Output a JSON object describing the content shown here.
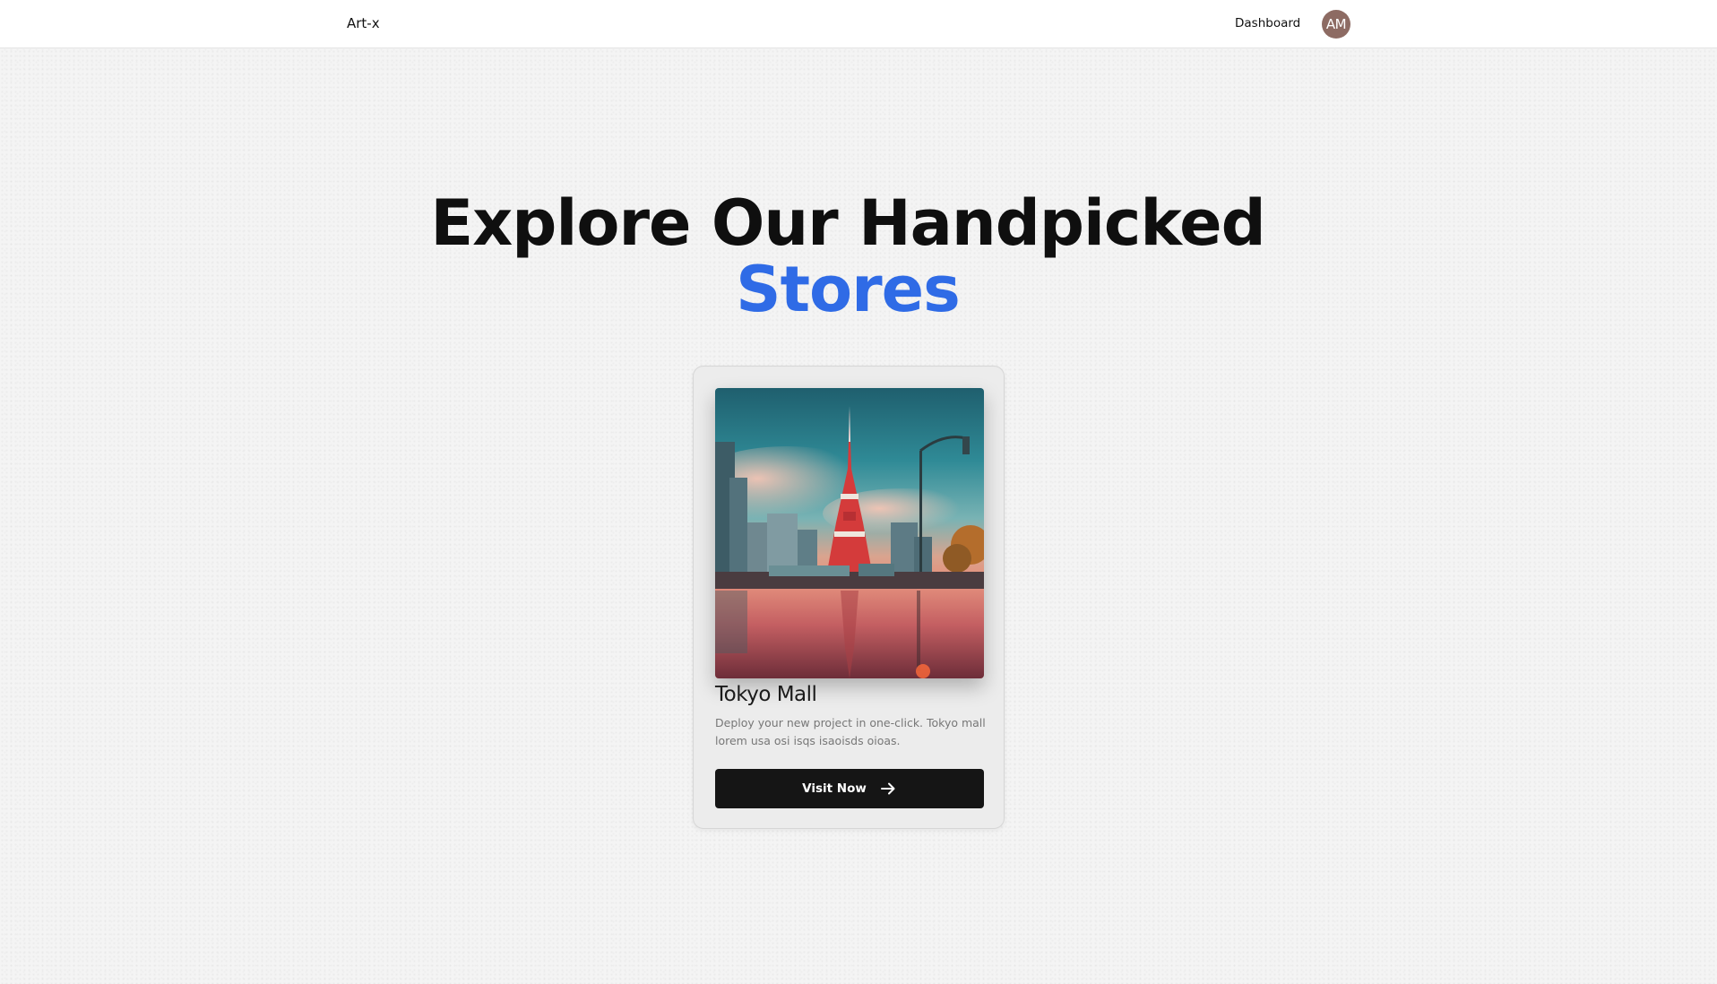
{
  "header": {
    "brand": "Art-x",
    "nav_dashboard": "Dashboard",
    "avatar_initials": "AM",
    "avatar_color": "#8d6b63"
  },
  "hero": {
    "line1": "Explore Our Handpicked",
    "line2": "Stores",
    "accent_color": "#2f6be6"
  },
  "stores": [
    {
      "title": "Tokyo Mall",
      "description": "Deploy your new project in one-click. Tokyo mall lorem usa osi isqs isaoisds oioas.",
      "button_label": "Visit Now",
      "button_icon": "arrow-right-icon",
      "image_subject": "tokyo-tower-photo"
    }
  ]
}
